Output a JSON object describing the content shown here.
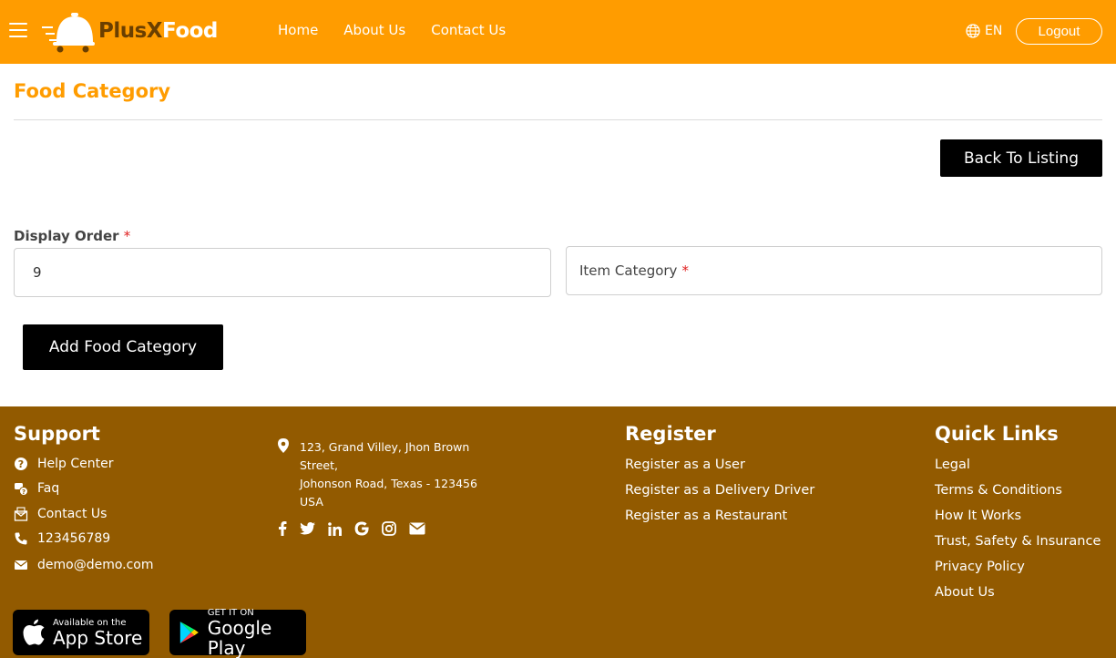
{
  "header": {
    "logo_part1": "PlusX",
    "logo_part2": "Food",
    "nav": [
      "Home",
      "About Us",
      "Contact Us"
    ],
    "language": "EN",
    "logout": "Logout"
  },
  "main": {
    "title": "Food Category",
    "back_button": "Back To Listing",
    "display_order_label": "Display Order",
    "display_order_value": "9",
    "item_category_label": "Item Category",
    "required_mark": "*",
    "add_button": "Add Food Category"
  },
  "footer": {
    "support_heading": "Support",
    "support_items": [
      "Help Center",
      "Faq",
      "Contact Us",
      "123456789",
      "demo@demo.com"
    ],
    "address": [
      "123, Grand Villey, Jhon Brown Street,",
      "Johonson Road, Texas - 123456",
      "USA"
    ],
    "socials": [
      "facebook-icon",
      "twitter-icon",
      "linkedin-icon",
      "google-icon",
      "instagram-icon",
      "envelope-icon"
    ],
    "register_heading": "Register",
    "register_links": [
      "Register as a User",
      "Register as a Delivery Driver",
      "Register as a Restaurant"
    ],
    "quick_heading": "Quick Links",
    "quick_links": [
      "Legal",
      "Terms & Conditions",
      "How It Works",
      "Trust, Safety & Insurance",
      "Privacy Policy",
      "About Us"
    ],
    "app_store_small": "Available on the",
    "app_store_big": "App Store",
    "play_store_small": "GET IT ON",
    "play_store_big": "Google Play"
  },
  "colors": {
    "brand": "#ff9c00",
    "footer": "#925a00",
    "button": "#000000"
  }
}
